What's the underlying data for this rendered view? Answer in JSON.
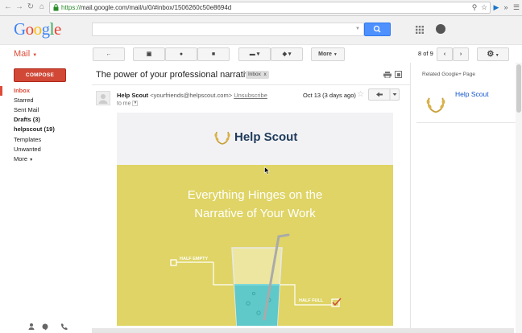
{
  "browser": {
    "url_protocol": "https://",
    "url_rest": "mail.google.com/mail/u/0/#inbox/1506260c50e8694d"
  },
  "header": {
    "logo": "Google",
    "logo_colors": [
      "#4285f4",
      "#ea4335",
      "#fbbc05",
      "#4285f4",
      "#34a853",
      "#ea4335"
    ]
  },
  "toolbar": {
    "mail_label": "Mail",
    "more_label": "More",
    "page_count": "8 of 9"
  },
  "sidebar": {
    "compose_label": "COMPOSE",
    "items": [
      {
        "label": "Inbox",
        "bold": true
      },
      {
        "label": "Starred",
        "bold": false
      },
      {
        "label": "Sent Mail",
        "bold": false
      },
      {
        "label": "Drafts (3)",
        "bold": true
      },
      {
        "label": "helpscout (19)",
        "bold": true
      },
      {
        "label": "Templates",
        "bold": false
      },
      {
        "label": "Unwanted",
        "bold": false
      },
      {
        "label": "More",
        "bold": false
      }
    ]
  },
  "message": {
    "subject": "The power of your professional narrative",
    "tag": "Inbox",
    "tag_close": "x",
    "sender_name": "Help Scout",
    "sender_email": "<yourfriends@helpscout.com>",
    "unsubscribe": "Unsubscribe",
    "to": "to me",
    "date": "Oct 13 (3 days ago)"
  },
  "email": {
    "brand_name": "Help Scout",
    "headline_1": "Everything Hinges on the",
    "headline_2": "Narrative of Your Work",
    "label_empty": "HALF EMPTY",
    "label_full": "HALF FULL"
  },
  "right_panel": {
    "related_label": "Related Google+ Page",
    "page_name": "Help Scout"
  },
  "colors": {
    "accent_red": "#dd4b39",
    "search_blue": "#4d90fe",
    "hero_yellow": "#dfd465",
    "brand_navy": "#1f3a5a"
  }
}
